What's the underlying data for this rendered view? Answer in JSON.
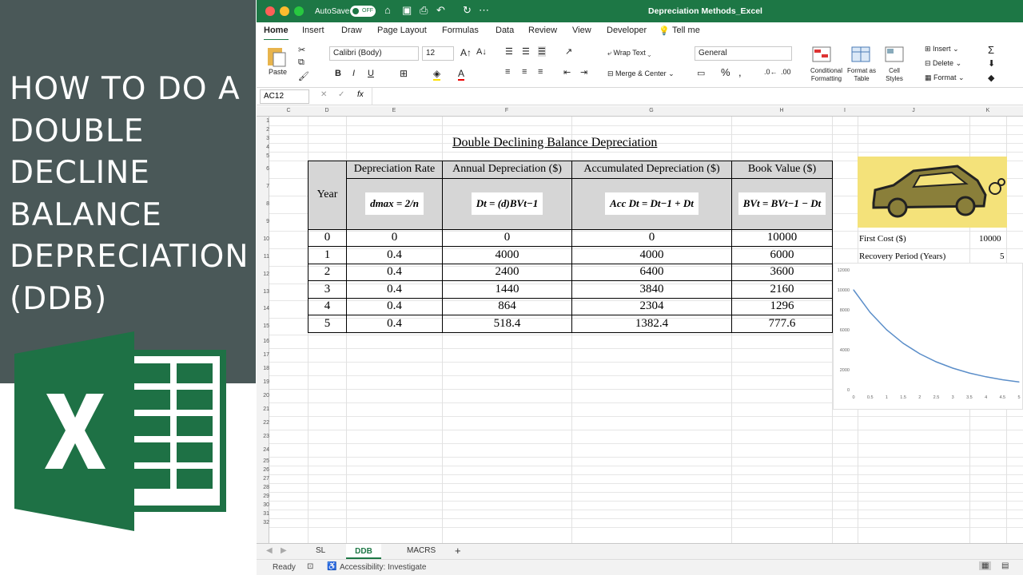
{
  "thumbnail": {
    "title": "HOW TO DO A DOUBLE DECLINE BALANCE DEPRECIATION (DDB)"
  },
  "titlebar": {
    "autosave": "AutoSave",
    "toggle": "OFF",
    "doc_title": "Depreciation Methods_Excel"
  },
  "menu": {
    "tabs": [
      "Home",
      "Insert",
      "Draw",
      "Page Layout",
      "Formulas",
      "Data",
      "Review",
      "View",
      "Developer",
      "Tell me"
    ]
  },
  "ribbon": {
    "paste": "Paste",
    "font_name": "Calibri (Body)",
    "font_size": "12",
    "wrap_text": "Wrap Text",
    "merge_center": "Merge & Center",
    "number_format": "General",
    "cond_format": "Conditional Formatting",
    "format_table": "Format as Table",
    "cell_styles": "Cell Styles",
    "insert": "Insert",
    "delete": "Delete",
    "format": "Format"
  },
  "formula_bar": {
    "name_box": "AC12",
    "fx": "fx"
  },
  "columns": [
    "C",
    "D",
    "E",
    "F",
    "G",
    "H",
    "I",
    "J",
    "K"
  ],
  "rows": [
    "1",
    "2",
    "3",
    "4",
    "5",
    "6",
    "7",
    "8",
    "9",
    "10",
    "11",
    "12",
    "13",
    "14",
    "15",
    "16",
    "17",
    "18",
    "19",
    "20",
    "21",
    "22",
    "23",
    "24",
    "25",
    "26",
    "27",
    "28",
    "29",
    "30",
    "31",
    "32"
  ],
  "sheet": {
    "title": "Double Declining Balance Depreciation",
    "headers": {
      "year": "Year",
      "rate": "Depreciation Rate",
      "annual": "Annual Depreciation ($)",
      "accum": "Accumulated Depreciation ($)",
      "book": "Book Value ($)"
    },
    "formulas": {
      "rate": "dmax = 2/n",
      "annual": "Dt = (d)BVt−1",
      "accum": "Acc Dt = Dt−1 + Dt",
      "book": "BVt = BVt−1 − Dt"
    },
    "data": [
      [
        "0",
        "0",
        "0",
        "0",
        "10000"
      ],
      [
        "1",
        "0.4",
        "4000",
        "4000",
        "6000"
      ],
      [
        "2",
        "0.4",
        "2400",
        "6400",
        "3600"
      ],
      [
        "3",
        "0.4",
        "1440",
        "3840",
        "2160"
      ],
      [
        "4",
        "0.4",
        "864",
        "2304",
        "1296"
      ],
      [
        "5",
        "0.4",
        "518.4",
        "1382.4",
        "777.6"
      ]
    ],
    "first_cost_label": "First Cost ($)",
    "first_cost": "10000",
    "recovery_label": "Recovery Period (Years)",
    "recovery": "5"
  },
  "chart_data": {
    "type": "line",
    "x": [
      0,
      0.5,
      1,
      1.5,
      2,
      2.5,
      3,
      3.5,
      4,
      4.5,
      5
    ],
    "series": [
      {
        "values": [
          10000,
          7746,
          6000,
          4648,
          3600,
          2789,
          2160,
          1673,
          1296,
          1004,
          777.6
        ]
      }
    ],
    "xticks": [
      "0",
      "0.5",
      "1",
      "1.5",
      "2",
      "2.5",
      "3",
      "3.5",
      "4",
      "4.5",
      "5"
    ],
    "yticks": [
      "0",
      "2000",
      "4000",
      "6000",
      "8000",
      "10000",
      "12000"
    ],
    "ylim": [
      0,
      12000
    ],
    "xlim": [
      0,
      5
    ],
    "color": "#5b8ec9"
  },
  "sheet_tabs": [
    "SL",
    "DDB",
    "MACRS"
  ],
  "status": {
    "ready": "Ready",
    "accessibility": "Accessibility: Investigate"
  }
}
